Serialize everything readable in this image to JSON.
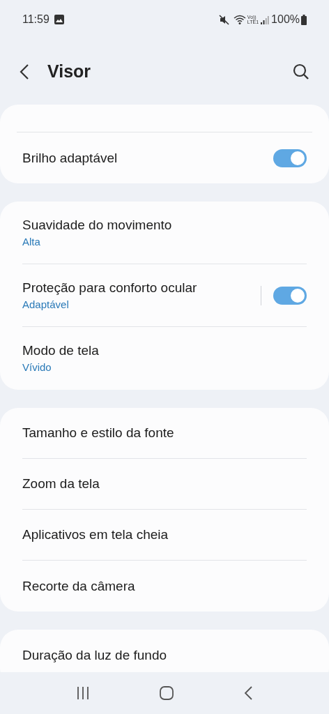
{
  "status_bar": {
    "time": "11:59",
    "volte": "Vo))",
    "network": "LTE1",
    "battery": "100%"
  },
  "header": {
    "title": "Visor"
  },
  "groups": [
    {
      "items": [
        {
          "kind": "toggle",
          "title": "Brilho adaptável",
          "on": true,
          "separated": false
        }
      ],
      "cut_top": true
    },
    {
      "items": [
        {
          "kind": "link",
          "title": "Suavidade do movimento",
          "subtitle": "Alta"
        },
        {
          "kind": "toggle",
          "title": "Proteção para conforto ocular",
          "subtitle": "Adaptável",
          "on": true,
          "separated": true
        },
        {
          "kind": "link",
          "title": "Modo de tela",
          "subtitle": "Vívido"
        }
      ]
    },
    {
      "items": [
        {
          "kind": "link",
          "title": "Tamanho e estilo da fonte"
        },
        {
          "kind": "link",
          "title": "Zoom da tela"
        },
        {
          "kind": "link",
          "title": "Aplicativos em tela cheia"
        },
        {
          "kind": "link",
          "title": "Recorte da câmera"
        }
      ]
    },
    {
      "items": [
        {
          "kind": "link",
          "title": "Duração da luz de fundo"
        }
      ],
      "cut_bottom": true
    }
  ]
}
